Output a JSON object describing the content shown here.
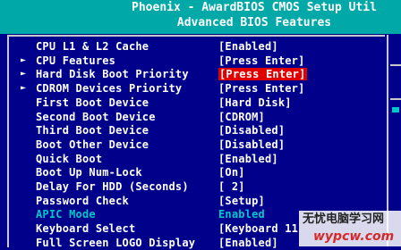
{
  "header": {
    "line1": "Phoenix - AwardBIOS CMOS Setup Util",
    "line2": "Advanced BIOS Features"
  },
  "items": [
    {
      "arrow": "",
      "label": "CPU L1 & L2 Cache",
      "value": "[Enabled]"
    },
    {
      "arrow": "►",
      "label": "CPU Features",
      "value": "[Press Enter]"
    },
    {
      "arrow": "►",
      "label": "Hard Disk Boot Priority",
      "value": "[Press Enter]",
      "highlighted": true
    },
    {
      "arrow": "►",
      "label": "CDROM Devices Priority",
      "value": "[Press Enter]"
    },
    {
      "arrow": "",
      "label": "First Boot Device",
      "value": "[Hard Disk]"
    },
    {
      "arrow": "",
      "label": "Second Boot Device",
      "value": "[CDROM]"
    },
    {
      "arrow": "",
      "label": "Third Boot Device",
      "value": "[Disabled]"
    },
    {
      "arrow": "",
      "label": "Boot Other Device",
      "value": "[Disabled]"
    },
    {
      "arrow": "",
      "label": "Quick Boot",
      "value": "[Enabled]"
    },
    {
      "arrow": "",
      "label": "Boot Up Num-Lock",
      "value": "[On]"
    },
    {
      "arrow": "",
      "label": "Delay For HDD (Seconds)",
      "value": "[ 2]"
    },
    {
      "arrow": "",
      "label": "Password Check",
      "value": "[Setup]"
    },
    {
      "arrow": "",
      "label": "APIC Mode",
      "value": "Enabled",
      "dim": true
    },
    {
      "arrow": "",
      "label": "Keyboard Select",
      "value": "[Keyboard 11"
    },
    {
      "arrow": "",
      "label": "Full Screen LOGO Display",
      "value": "[Enabled]"
    }
  ],
  "watermark": {
    "line1": "无忧电脑学习网",
    "line2": "wypcw.com"
  },
  "colors": {
    "background": "#00008a",
    "header": "#00a8a8",
    "highlight": "#e00000",
    "dim_text": "#00c8c8"
  }
}
